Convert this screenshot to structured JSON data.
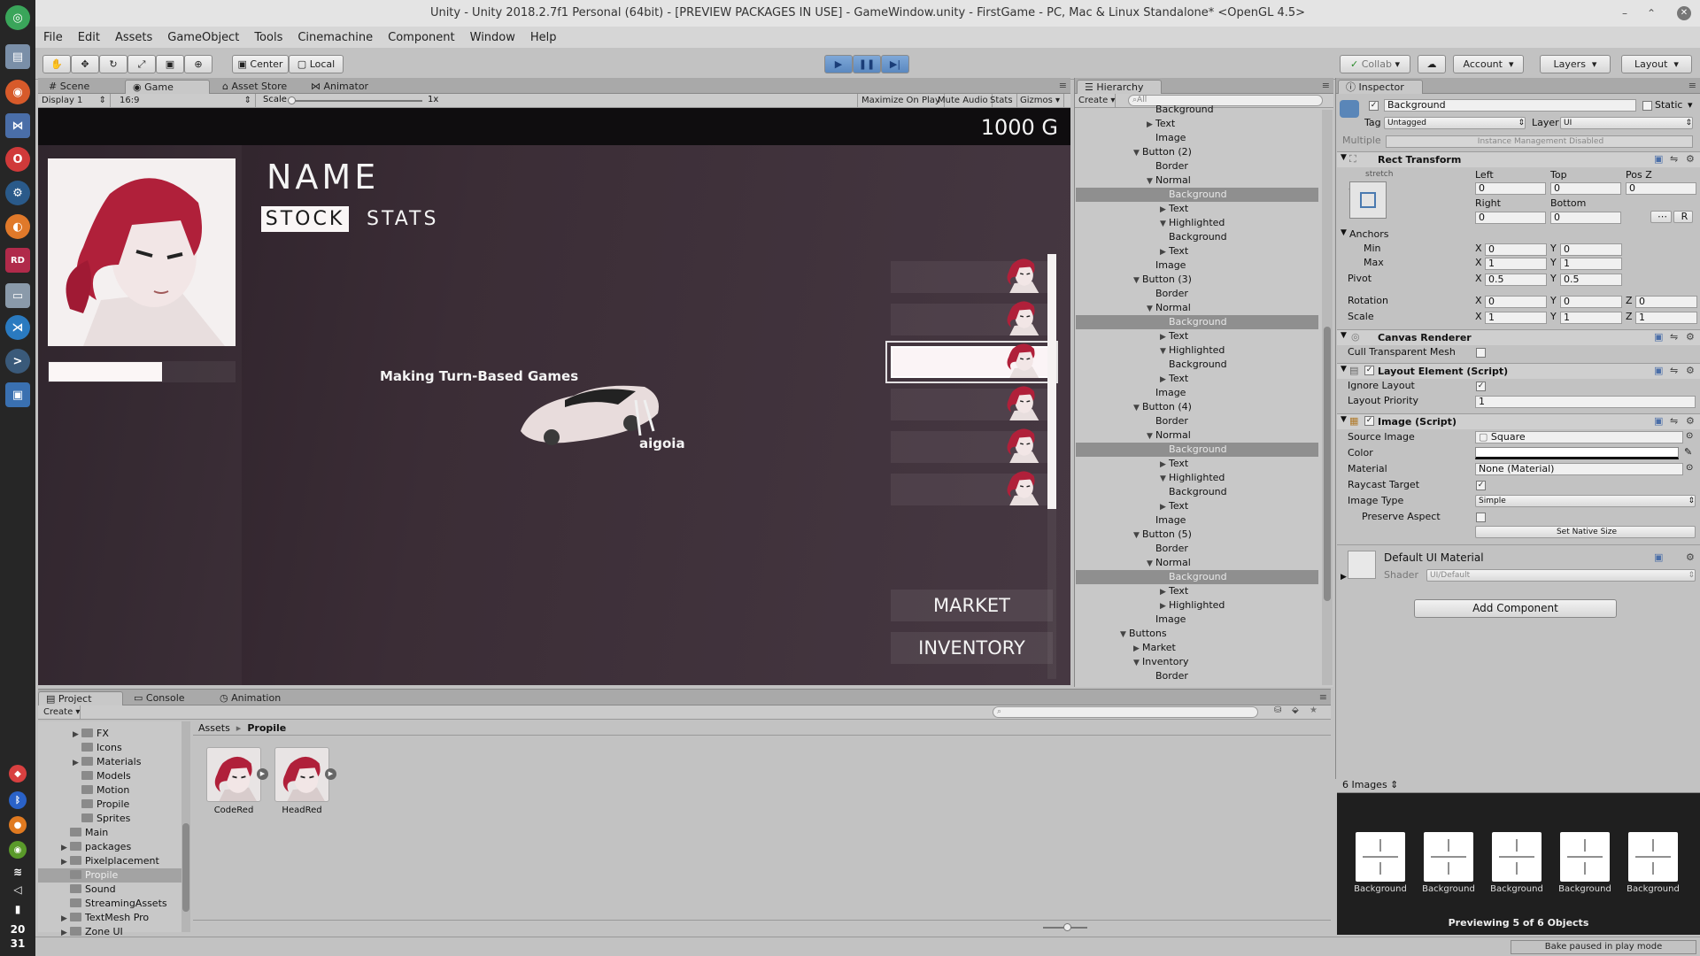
{
  "window": {
    "title": "Unity - Unity 2018.2.7f1 Personal (64bit) - [PREVIEW PACKAGES IN USE] - GameWindow.unity - FirstGame - PC, Mac & Linux Standalone* <OpenGL 4.5>"
  },
  "menu": [
    "File",
    "Edit",
    "Assets",
    "GameObject",
    "Tools",
    "Cinemachine",
    "Component",
    "Window",
    "Help"
  ],
  "toolbar": {
    "center": "Center",
    "local": "Local",
    "collab": "Collab",
    "account": "Account",
    "layers": "Layers",
    "layout": "Layout"
  },
  "scene_tabs": [
    "Scene",
    "Game",
    "Asset Store",
    "Animator"
  ],
  "game_bar": {
    "display": "Display 1",
    "aspect": "16:9",
    "scale_label": "Scale",
    "scale_value": "1x",
    "maximize": "Maximize On Play",
    "mute": "Mute Audio",
    "stats": "Stats",
    "gizmos": "Gizmos"
  },
  "game": {
    "gold": "1000 G",
    "name": "NAME",
    "tab_stock": "STOCK",
    "tab_stats": "STATS",
    "caption": "Making Turn-Based Games",
    "credit": "aigoia",
    "market": "MARKET",
    "inventory": "INVENTORY"
  },
  "hierarchy": {
    "title": "Hierarchy",
    "create": "Create",
    "search_placeholder": "All",
    "rows": [
      {
        "label": "Background",
        "indent": 3,
        "arrow": ""
      },
      {
        "label": "Text",
        "indent": 3,
        "arrow": "right"
      },
      {
        "label": "Image",
        "indent": 3,
        "arrow": ""
      },
      {
        "label": "Button (2)",
        "indent": 2,
        "arrow": "down"
      },
      {
        "label": "Border",
        "indent": 3,
        "arrow": ""
      },
      {
        "label": "Normal",
        "indent": 3,
        "arrow": "down"
      },
      {
        "label": "Background",
        "indent": 4,
        "arrow": "",
        "selected": true
      },
      {
        "label": "Text",
        "indent": 4,
        "arrow": "right"
      },
      {
        "label": "Highlighted",
        "indent": 4,
        "arrow": "down"
      },
      {
        "label": "Background",
        "indent": 4,
        "arrow": ""
      },
      {
        "label": "Text",
        "indent": 4,
        "arrow": "right"
      },
      {
        "label": "Image",
        "indent": 3,
        "arrow": ""
      },
      {
        "label": "Button (3)",
        "indent": 2,
        "arrow": "down"
      },
      {
        "label": "Border",
        "indent": 3,
        "arrow": ""
      },
      {
        "label": "Normal",
        "indent": 3,
        "arrow": "down"
      },
      {
        "label": "Background",
        "indent": 4,
        "arrow": "",
        "selected": true
      },
      {
        "label": "Text",
        "indent": 4,
        "arrow": "right"
      },
      {
        "label": "Highlighted",
        "indent": 4,
        "arrow": "down"
      },
      {
        "label": "Background",
        "indent": 4,
        "arrow": ""
      },
      {
        "label": "Text",
        "indent": 4,
        "arrow": "right"
      },
      {
        "label": "Image",
        "indent": 3,
        "arrow": ""
      },
      {
        "label": "Button (4)",
        "indent": 2,
        "arrow": "down"
      },
      {
        "label": "Border",
        "indent": 3,
        "arrow": ""
      },
      {
        "label": "Normal",
        "indent": 3,
        "arrow": "down"
      },
      {
        "label": "Background",
        "indent": 4,
        "arrow": "",
        "selected": true
      },
      {
        "label": "Text",
        "indent": 4,
        "arrow": "right"
      },
      {
        "label": "Highlighted",
        "indent": 4,
        "arrow": "down"
      },
      {
        "label": "Background",
        "indent": 4,
        "arrow": ""
      },
      {
        "label": "Text",
        "indent": 4,
        "arrow": "right"
      },
      {
        "label": "Image",
        "indent": 3,
        "arrow": ""
      },
      {
        "label": "Button (5)",
        "indent": 2,
        "arrow": "down"
      },
      {
        "label": "Border",
        "indent": 3,
        "arrow": ""
      },
      {
        "label": "Normal",
        "indent": 3,
        "arrow": "down"
      },
      {
        "label": "Background",
        "indent": 4,
        "arrow": "",
        "selected": true
      },
      {
        "label": "Text",
        "indent": 4,
        "arrow": "right"
      },
      {
        "label": "Highlighted",
        "indent": 4,
        "arrow": "right"
      },
      {
        "label": "Image",
        "indent": 3,
        "arrow": ""
      },
      {
        "label": "Buttons",
        "indent": 1,
        "arrow": "down"
      },
      {
        "label": "Market",
        "indent": 2,
        "arrow": "right"
      },
      {
        "label": "Inventory",
        "indent": 2,
        "arrow": "down"
      },
      {
        "label": "Border",
        "indent": 3,
        "arrow": ""
      }
    ]
  },
  "inspector": {
    "title": "Inspector",
    "object_name": "Background",
    "static_label": "Static",
    "tag_label": "Tag",
    "tag_value": "Untagged",
    "layer_label": "Layer",
    "layer_value": "UI",
    "multiple_label": "Multiple",
    "multiple_value": "Instance Management Disabled",
    "rect": {
      "title": "Rect Transform",
      "stretch_top": "stretch",
      "stretch_side": "stretch",
      "left": "Left",
      "top": "Top",
      "posz": "Pos Z",
      "left_v": "0",
      "top_v": "0",
      "posz_v": "0",
      "right": "Right",
      "bottom": "Bottom",
      "right_v": "0",
      "bottom_v": "0",
      "r_btn": "R",
      "anchors": "Anchors",
      "min": "Min",
      "max": "Max",
      "pivot": "Pivot",
      "rotation": "Rotation",
      "scale": "Scale",
      "x": "X",
      "y": "Y",
      "z": "Z",
      "min_x": "0",
      "min_y": "0",
      "max_x": "1",
      "max_y": "1",
      "pivot_x": "0.5",
      "pivot_y": "0.5",
      "rot_x": "0",
      "rot_y": "0",
      "rot_z": "0",
      "scale_x": "1",
      "scale_y": "1",
      "scale_z": "1"
    },
    "canvas_renderer": {
      "title": "Canvas Renderer",
      "cull": "Cull Transparent Mesh"
    },
    "layout_element": {
      "title": "Layout Element (Script)",
      "ignore": "Ignore Layout",
      "priority": "Layout Priority",
      "priority_v": "1"
    },
    "image": {
      "title": "Image (Script)",
      "source": "Source Image",
      "source_v": "Square",
      "color": "Color",
      "material": "Material",
      "material_v": "None (Material)",
      "raycast": "Raycast Target",
      "type": "Image Type",
      "type_v": "Simple",
      "preserve": "Preserve Aspect",
      "native": "Set Native Size"
    },
    "material": {
      "title": "Default UI Material",
      "shader": "Shader",
      "shader_v": "UI/Default"
    },
    "add_component": "Add Component"
  },
  "preview": {
    "header": "6 Images",
    "items": [
      "Background",
      "Background",
      "Background",
      "Background",
      "Background"
    ],
    "footer": "Previewing 5 of 6 Objects"
  },
  "project": {
    "tabs": [
      "Project",
      "Console",
      "Animation"
    ],
    "create": "Create",
    "breadcrumb": [
      "Assets",
      "Propile"
    ],
    "tree": [
      {
        "label": "FX",
        "indent": 2,
        "arrow": "right"
      },
      {
        "label": "Icons",
        "indent": 2,
        "arrow": ""
      },
      {
        "label": "Materials",
        "indent": 2,
        "arrow": "right"
      },
      {
        "label": "Models",
        "indent": 2,
        "arrow": ""
      },
      {
        "label": "Motion",
        "indent": 2,
        "arrow": ""
      },
      {
        "label": "Propile",
        "indent": 2,
        "arrow": ""
      },
      {
        "label": "Sprites",
        "indent": 2,
        "arrow": ""
      },
      {
        "label": "Main",
        "indent": 1,
        "arrow": ""
      },
      {
        "label": "packages",
        "indent": 1,
        "arrow": "right"
      },
      {
        "label": "Pixelplacement",
        "indent": 1,
        "arrow": "right"
      },
      {
        "label": "Propile",
        "indent": 1,
        "arrow": "",
        "selected": true
      },
      {
        "label": "Sound",
        "indent": 1,
        "arrow": ""
      },
      {
        "label": "StreamingAssets",
        "indent": 1,
        "arrow": ""
      },
      {
        "label": "TextMesh Pro",
        "indent": 1,
        "arrow": "right"
      },
      {
        "label": "Zone UI",
        "indent": 1,
        "arrow": "right"
      }
    ],
    "assets": [
      "CodeRed",
      "HeadRed"
    ]
  },
  "status": {
    "bake": "Bake paused in play mode"
  },
  "clock": {
    "hour": "20",
    "minute": "31"
  },
  "colors": {
    "accent_blue": "#5a88c0",
    "game_bg": "#2f242c",
    "hair_red": "#b0203a",
    "selection": "#8f8f8f"
  }
}
